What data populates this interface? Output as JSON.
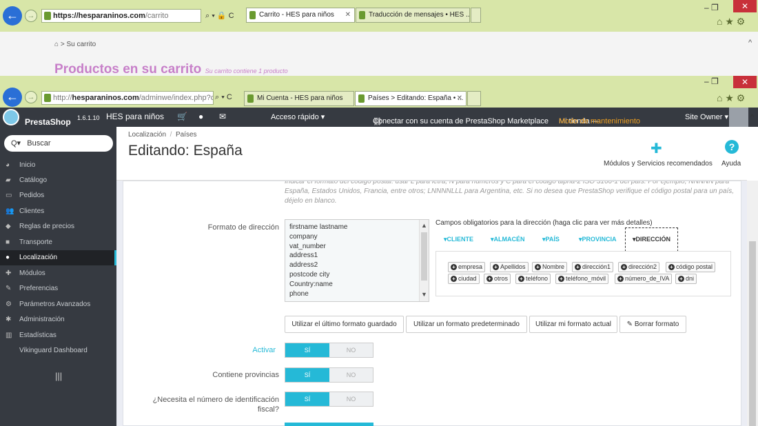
{
  "browser1": {
    "url_host": "https://hesparaninos.com",
    "url_path": "/carrito",
    "addr_controls": "⌕ ▾ 🔒 C",
    "tabs": [
      {
        "label": "Carrito - HES para niños",
        "close": "✕"
      },
      {
        "label": "Traducción de mensajes • HES ..."
      }
    ],
    "window_controls": "–  ❐",
    "close": "✕"
  },
  "page1": {
    "breadcrumb": "Su carrito",
    "title": "Productos en su carrito",
    "subtitle": "Su carrito contiene 1 producto"
  },
  "browser2": {
    "url_prefix": "http://",
    "url_host": "hesparaninos.com",
    "url_path": "/adminwe/index.php?control",
    "addr_controls": "⌕ ▾ C",
    "tabs": [
      {
        "label": "Mi Cuenta - HES para niños"
      },
      {
        "label": "Países > Editando: España • ...",
        "close": "✕"
      }
    ],
    "window_controls": "–  ❐",
    "close": "✕"
  },
  "topbar": {
    "brand": "PrestaShop",
    "version": "1.6.1.10",
    "shop_name": "HES para niños",
    "quick_access": "Acceso rápido ▾",
    "marketplace": "Conectar con su cuenta de PrestaShop Marketplace",
    "store_label": "Mi tienda —",
    "maintenance": "Modo de mantenimiento",
    "user": "Site Owner ▾"
  },
  "sidebar": {
    "search_placeholder": "Buscar",
    "items": [
      {
        "label": "Inicio",
        "icon": "dashboard-icon"
      },
      {
        "label": "Catálogo",
        "icon": "book-icon"
      },
      {
        "label": "Pedidos",
        "icon": "card-icon"
      },
      {
        "label": "Clientes",
        "icon": "users-icon"
      },
      {
        "label": "Reglas de precios",
        "icon": "tag-icon"
      },
      {
        "label": "Transporte",
        "icon": "truck-icon"
      },
      {
        "label": "Localización",
        "icon": "globe-icon"
      },
      {
        "label": "Módulos",
        "icon": "puzzle-icon"
      },
      {
        "label": "Preferencias",
        "icon": "wrench-icon"
      },
      {
        "label": "Parámetros Avanzados",
        "icon": "cogs-icon"
      },
      {
        "label": "Administración",
        "icon": "gear-icon"
      },
      {
        "label": "Estadísticas",
        "icon": "bar-chart-icon"
      },
      {
        "label": "Vikinguard Dashboard",
        "icon": ""
      }
    ],
    "bottom_icon": "|||"
  },
  "header": {
    "breadcrumb_1": "Localización",
    "breadcrumb_sep": "/",
    "breadcrumb_2": "Países",
    "title": "Editando: España",
    "modules_link": "Módulos y Servicios recomendados",
    "help_link": "Ayuda"
  },
  "form": {
    "help_text": "Indicar el formato del código postal: usar L para letra, N para números y C para el código alpha-2 ISO 3166-1 del país. Por ejemplo, NNNNN para España, Estados Unidos, Francia, entre otros; LNNNNLLL para Argentina, etc. Si no desea que PrestaShop verifique el código postal para un país, déjelo en blanco.",
    "address_format_label": "Formato de dirección",
    "address_format_lines": [
      "firstname lastname",
      "company",
      "vat_number",
      "address1",
      "address2",
      "postcode city",
      "Country:name",
      "phone"
    ],
    "required_fields_title": "Campos obligatorios para la dirección (haga clic para ver más detalles)",
    "field_tabs": [
      "▾CLIENTE",
      "▾ALMACÉN",
      "▾PAÍS",
      "▾PROVINCIA",
      "▾DIRECCIÓN"
    ],
    "field_chips_row1": [
      "empresa",
      "Apellidos",
      "Nombre",
      "dirección1",
      "dirección2",
      "código postal"
    ],
    "field_chips_row2": [
      "ciudad",
      "otros",
      "teléfono",
      "teléfono_móvil",
      "número_de_IVA",
      "dni"
    ],
    "buttons": {
      "last_saved": "Utilizar el último formato guardado",
      "default": "Utilizar un formato predeterminado",
      "current": "Utilizar mi formato actual",
      "clear": "Borrar formato"
    },
    "toggles": [
      {
        "label": "Activar",
        "on": "SÍ",
        "off": "NO"
      },
      {
        "label": "Contiene provincias",
        "on": "SÍ",
        "off": "NO"
      },
      {
        "label": "¿Necesita el número de identificación fiscal?",
        "on": "SÍ",
        "off": "NO"
      }
    ]
  },
  "colors": {
    "accent": "#25b9d7",
    "sidebar": "#363a41",
    "chrome": "#d8e6a8",
    "maintenance": "#f0a020",
    "pink": "#c77fc9"
  }
}
